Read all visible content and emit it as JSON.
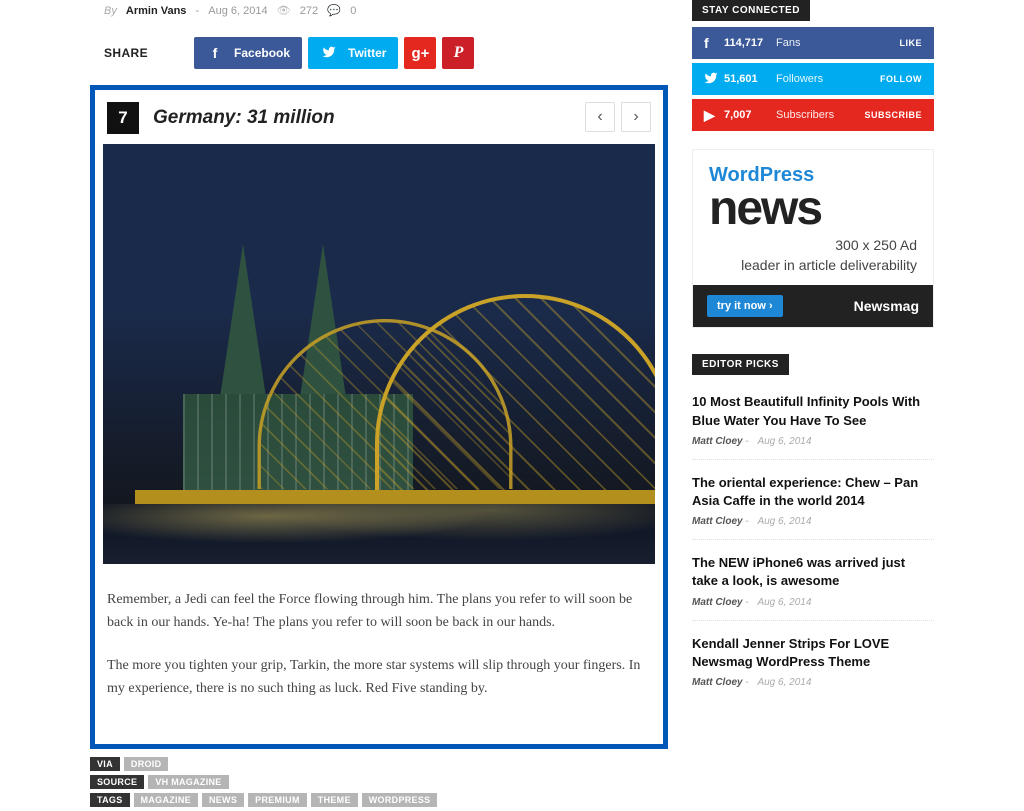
{
  "meta": {
    "by": "By",
    "author": "Armin Vans",
    "date": "Aug 6, 2014",
    "views": "272",
    "comments": "0"
  },
  "share": {
    "label": "SHARE",
    "facebook": "Facebook",
    "twitter": "Twitter"
  },
  "card": {
    "number": "7",
    "title": "Germany: 31 million",
    "p1": "Remember, a Jedi can feel the Force flowing through him. The plans you refer to will soon be back in our hands. Ye-ha! The plans you refer to will soon be back in our hands.",
    "p2": "The more you tighten your grip, Tarkin, the more star systems will slip through your fingers. In my experience, there is no such thing as luck. Red Five standing by."
  },
  "tagbox": {
    "via_label": "VIA",
    "via_value": "DROID",
    "source_label": "SOURCE",
    "source_value": "VH MAGAZINE",
    "tags_label": "TAGS",
    "tags": [
      "MAGAZINE",
      "NEWS",
      "PREMIUM",
      "THEME",
      "WORDPRESS"
    ]
  },
  "sidebar": {
    "stay_connected_title": "STAY CONNECTED",
    "social": {
      "fb_count": "114,717",
      "fb_label": "Fans",
      "fb_action": "LIKE",
      "tw_count": "51,601",
      "tw_label": "Followers",
      "tw_action": "FOLLOW",
      "yt_count": "7,007",
      "yt_label": "Subscribers",
      "yt_action": "SUBSCRIBE"
    },
    "ad": {
      "wp": "WordPress",
      "news": "news",
      "line1": "300 x 250 Ad",
      "line2": "leader in article deliverability",
      "try": "try it now  ›",
      "brand": "Newsmag"
    },
    "editor_picks_title": "EDITOR PICKS",
    "picks": [
      {
        "title": "10 Most Beautifull Infinity Pools With Blue Water You Have To See",
        "author": "Matt Cloey",
        "date": "Aug 6, 2014"
      },
      {
        "title": "The oriental experience: Chew – Pan Asia Caffe in the world 2014",
        "author": "Matt Cloey",
        "date": "Aug 6, 2014"
      },
      {
        "title": "The NEW iPhone6 was arrived just take a look, is awesome",
        "author": "Matt Cloey",
        "date": "Aug 6, 2014"
      },
      {
        "title": "Kendall Jenner Strips For LOVE Newsmag WordPress Theme",
        "author": "Matt Cloey",
        "date": "Aug 6, 2014"
      }
    ]
  }
}
